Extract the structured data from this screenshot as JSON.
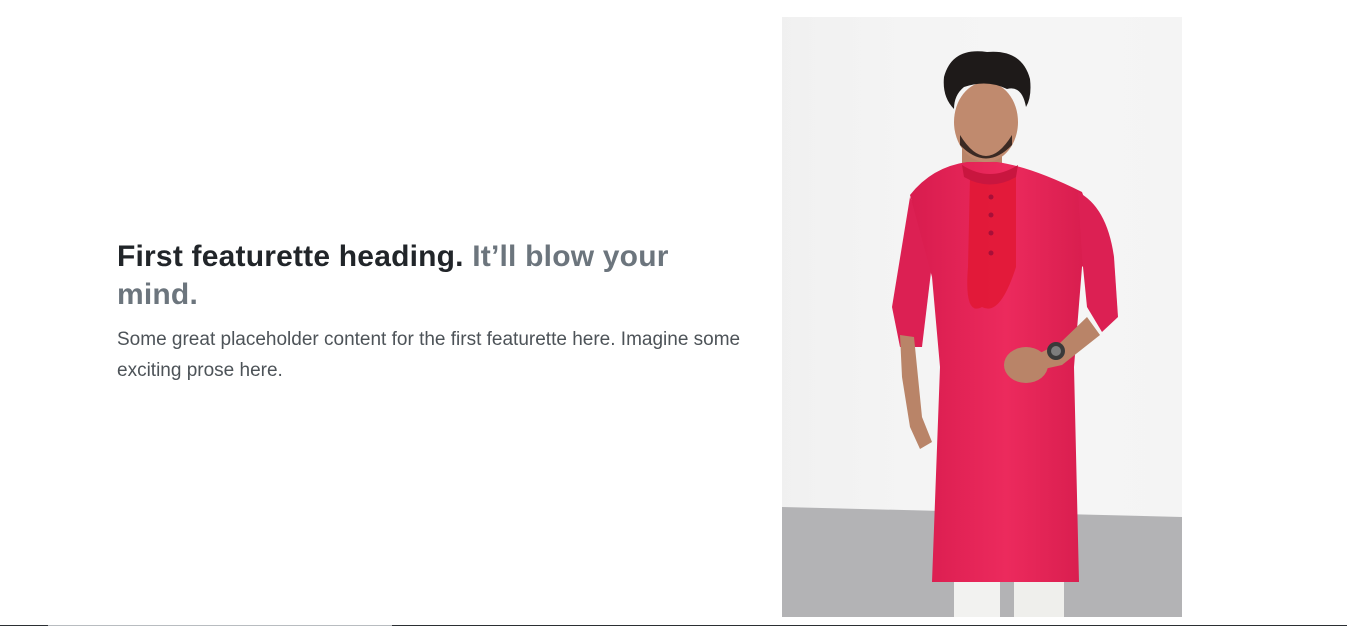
{
  "featurette": {
    "heading": "First featurette heading.",
    "heading_muted": "It’ll blow your mind.",
    "lead": "Some great placeholder content for the first featurette here. Imagine some exciting prose here."
  },
  "image": {
    "description": "man-in-pink-kurta-photo"
  },
  "colors": {
    "heading": "#212529",
    "muted": "#6c757d",
    "kurta": "#e8245a",
    "wall": "#f4f4f4",
    "floor": "#b3b3b5"
  }
}
